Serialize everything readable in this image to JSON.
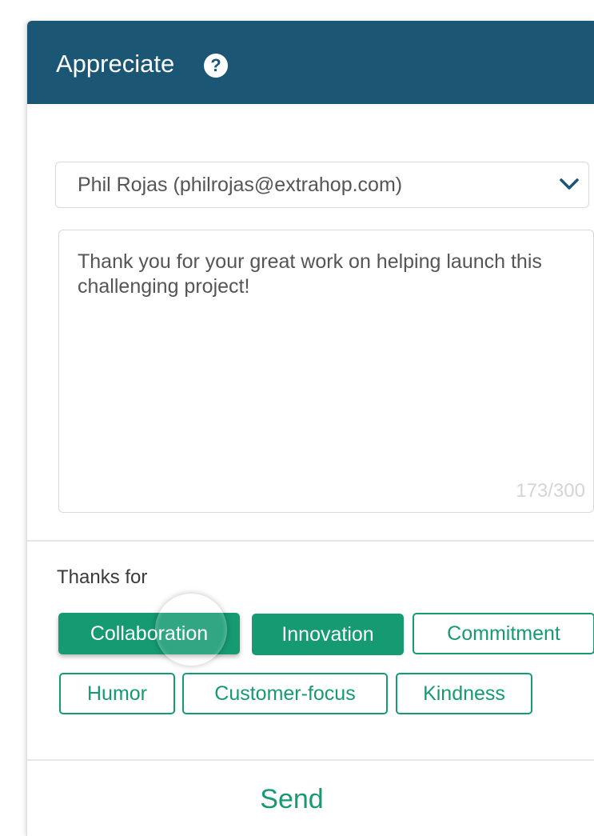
{
  "header": {
    "title": "Appreciate",
    "help_glyph": "?",
    "help_icon": "question-circle-icon"
  },
  "recipient": {
    "selected": "Phil Rojas (philrojas@extrahop.com)",
    "dropdown_icon": "chevron-down-icon"
  },
  "message": {
    "value": "Thank you for your great work on helping launch this challenging project!",
    "counter": "173/300"
  },
  "thanks": {
    "label": "Thanks for",
    "chips": [
      {
        "label": "Collaboration",
        "selected": true
      },
      {
        "label": "Innovation",
        "selected": true
      },
      {
        "label": "Commitment",
        "selected": false
      },
      {
        "label": "Humor",
        "selected": false
      },
      {
        "label": "Customer-focus",
        "selected": false
      },
      {
        "label": "Kindness",
        "selected": false
      }
    ]
  },
  "actions": {
    "send_label": "Send"
  },
  "colors": {
    "header_bg": "#1b5775",
    "accent_green": "#169a72",
    "border": "#d9d9d9",
    "counter_text": "#d5d5d5"
  }
}
